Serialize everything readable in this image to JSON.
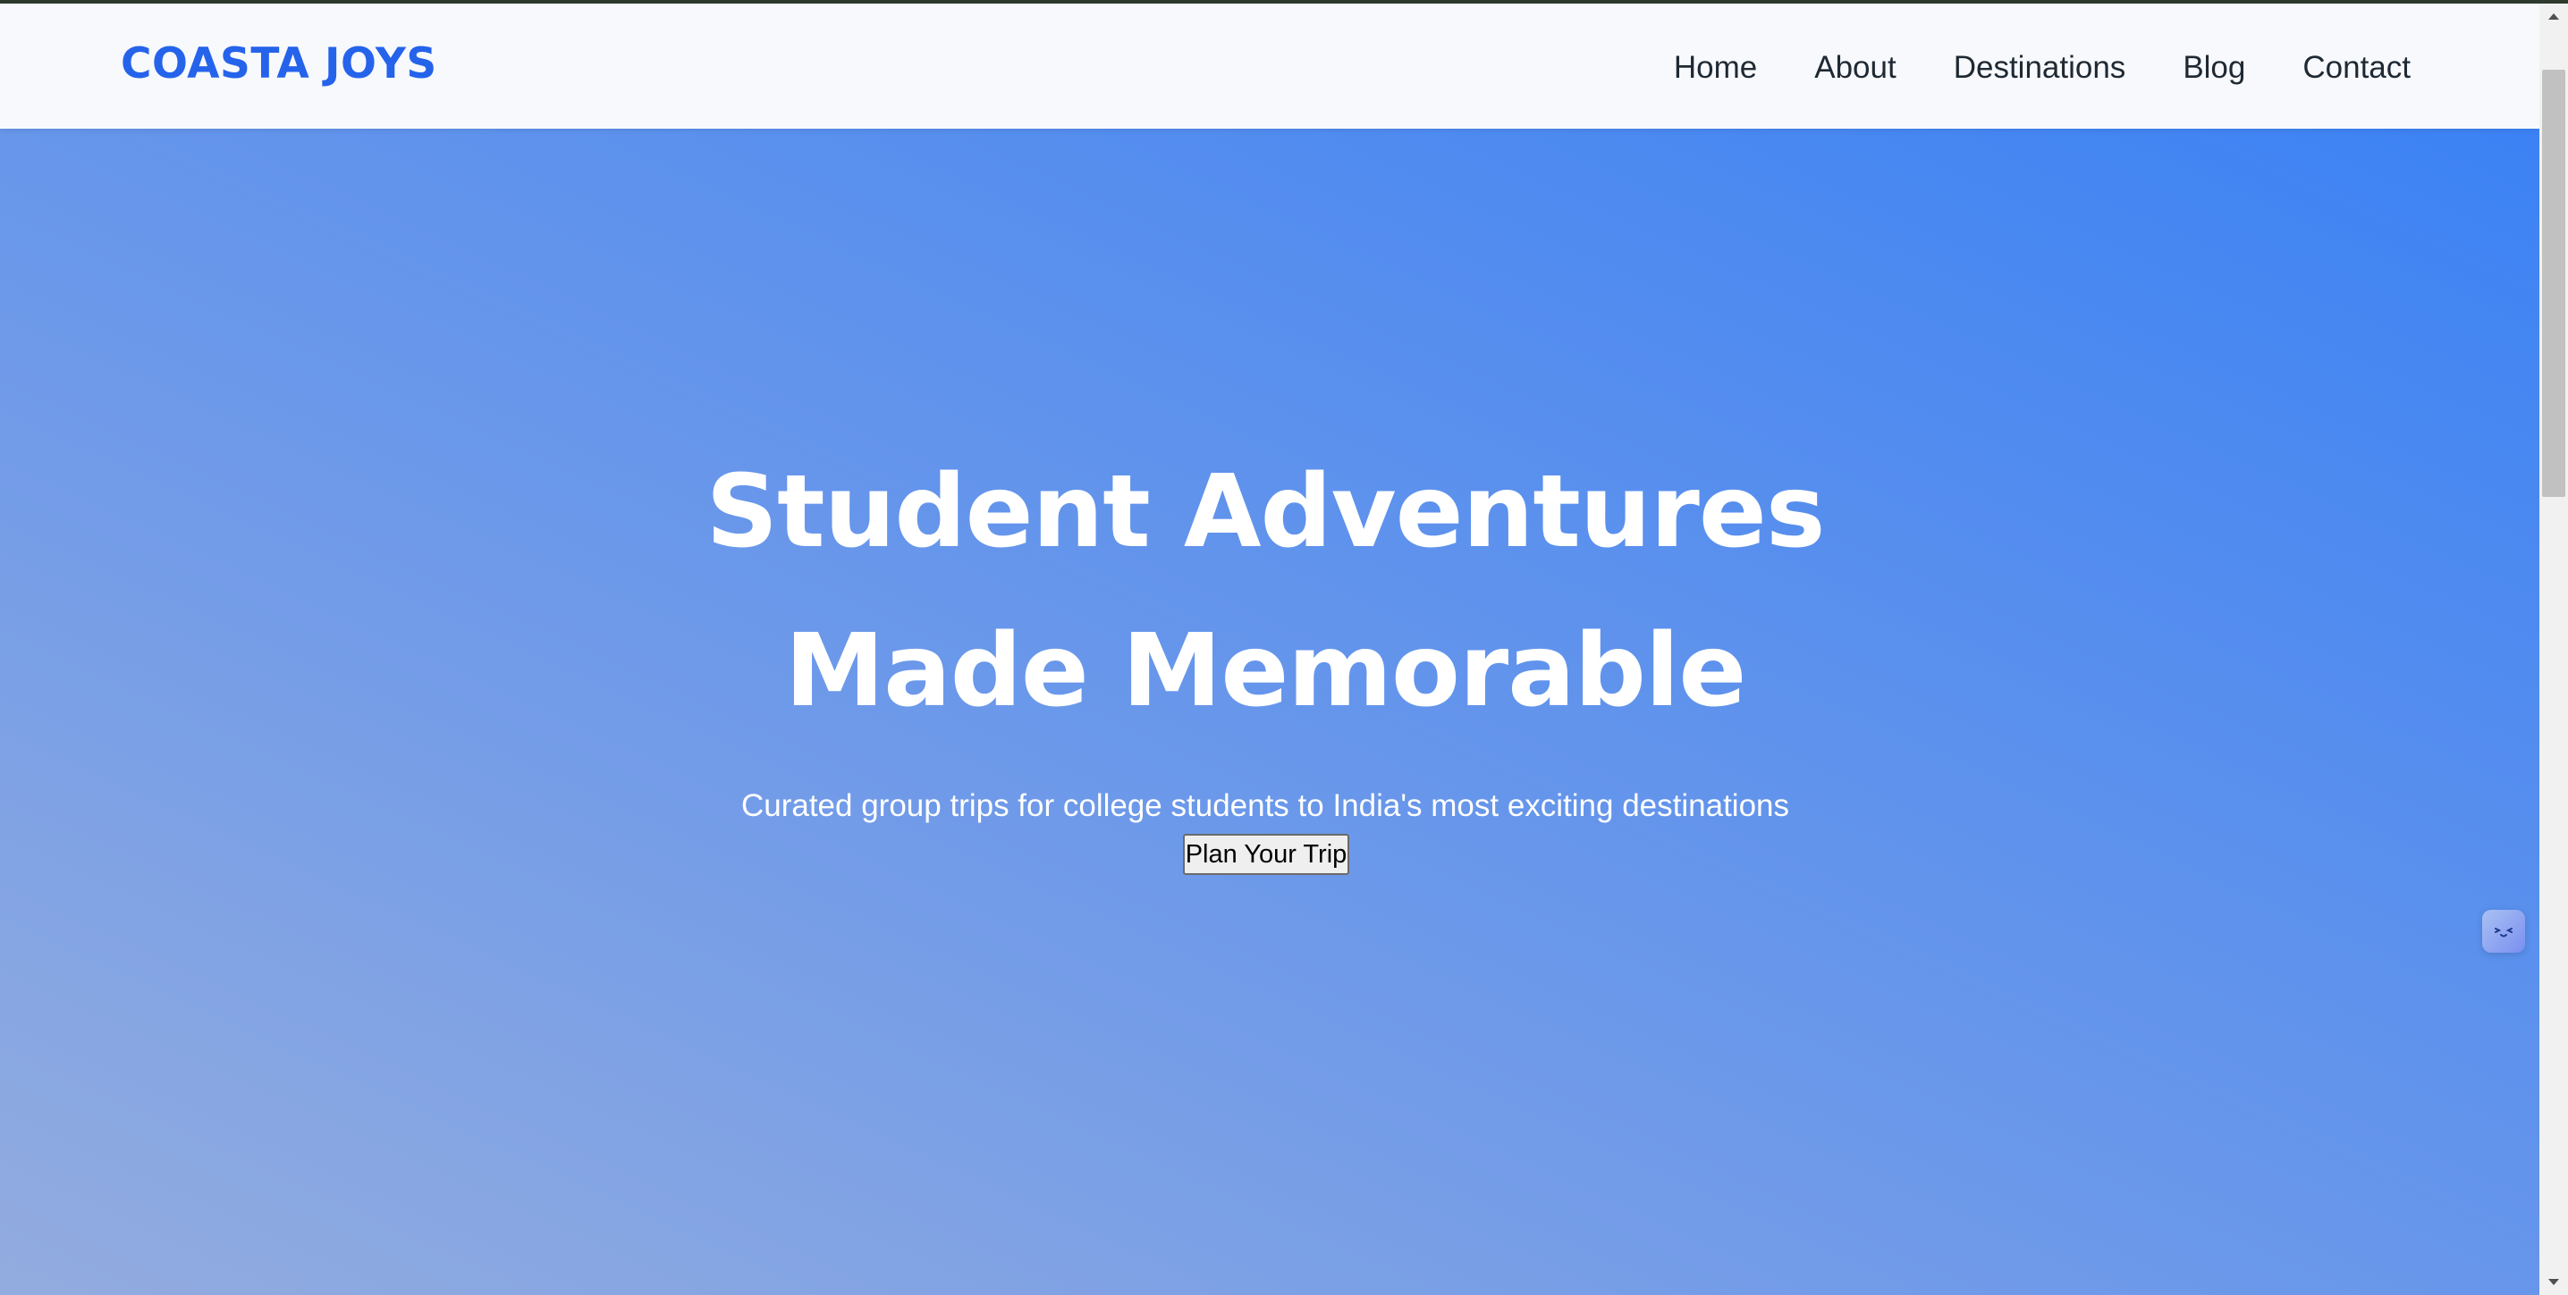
{
  "brand": {
    "name": "COASTA JOYS"
  },
  "nav": {
    "items": [
      {
        "label": "Home"
      },
      {
        "label": "About"
      },
      {
        "label": "Destinations"
      },
      {
        "label": "Blog"
      },
      {
        "label": "Contact"
      }
    ]
  },
  "hero": {
    "title_line1": "Student Adventures",
    "title_line2": "Made Memorable",
    "subtitle": "Curated group trips for college students to India's most exciting destinations",
    "cta_label": "Plan Your Trip"
  },
  "widgets": {
    "assistant_icon": "face-icon"
  },
  "colors": {
    "brand": "#2563eb",
    "hero_gradient_start": "#93acdf",
    "hero_gradient_end": "#3c82f4",
    "nav_background": "#f7f9fc"
  }
}
